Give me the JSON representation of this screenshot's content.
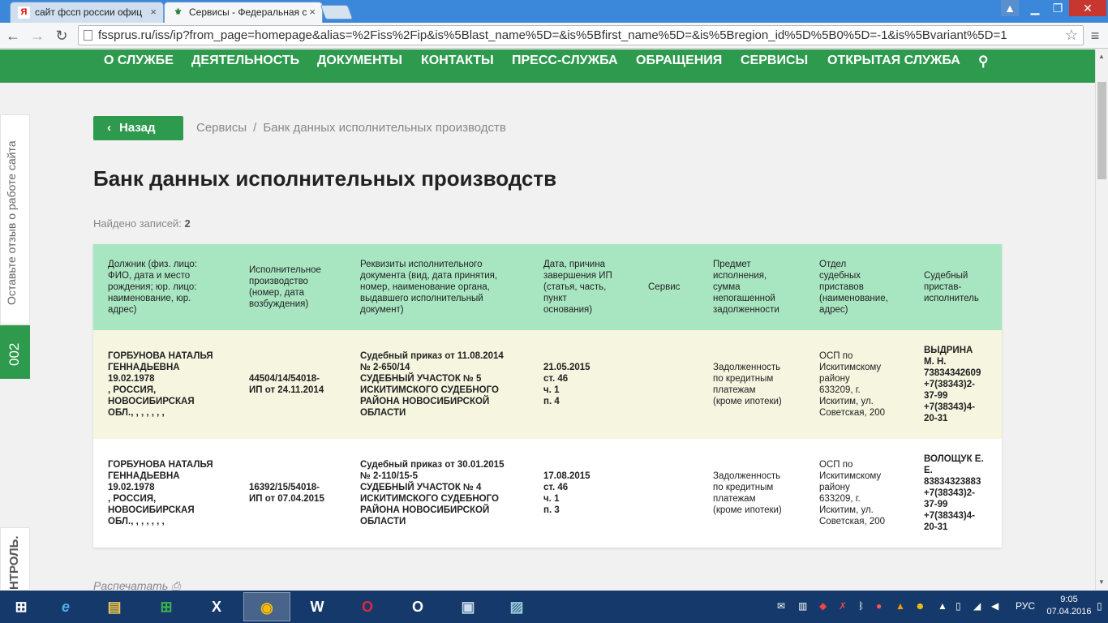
{
  "browser": {
    "tabs": [
      {
        "favicon": "Я",
        "label": "сайт фссп россии офиц",
        "active": false
      },
      {
        "favicon": "⚜",
        "label": "Сервисы - Федеральная с",
        "active": true
      }
    ],
    "url": "fssprus.ru/iss/ip?from_page=homepage&alias=%2Fiss%2Fip&is%5Blast_name%5D=&is%5Bfirst_name%5D=&is%5Bregion_id%5D%5B0%5D=-1&is%5Bvariant%5D=1",
    "window_buttons": [
      "▁",
      "❐",
      "✕"
    ]
  },
  "nav": {
    "items": [
      "О СЛУЖБЕ",
      "ДЕЯТЕЛЬНОСТЬ",
      "ДОКУМЕНТЫ",
      "КОНТАКТЫ",
      "ПРЕСС-СЛУЖБА",
      "ОБРАЩЕНИЯ",
      "СЕРВИСЫ",
      "ОТКРЫТАЯ СЛУЖБА"
    ],
    "search_icon": "search-icon"
  },
  "side": {
    "feedback": "Оставьте отзыв о работе сайта",
    "counter": "002",
    "kontrol": "НТРОЛЬ."
  },
  "page": {
    "back_label": "Назад",
    "breadcrumb": [
      "Сервисы",
      "Банк данных исполнительных производств"
    ],
    "breadcrumb_sep": "/",
    "title": "Банк данных исполнительных производств",
    "found_label": "Найдено записей:",
    "found_count": "2",
    "print_label": "Распечатать"
  },
  "table": {
    "headers": [
      "Должник (физ. лицо:\nФИО, дата и место\nрождения; юр. лицо:\nнаименование, юр.\nадрес)",
      "Исполнительное\nпроизводство\n(номер, дата\nвозбуждения)",
      "Реквизиты исполнительного\nдокумента (вид, дата принятия,\nномер, наименование органа,\nвыдавшего исполнительный\nдокумент)",
      "Дата, причина\nзавершения ИП\n(статья, часть,\nпункт\nоснования)",
      "Сервис",
      "Предмет\nисполнения,\nсумма\nнепогашенной\nзадолженности",
      "Отдел\nсудебных\nприставов\n(наименование,\nадрес)",
      "Судебный\nпристав-\nисполнитель"
    ],
    "rows": [
      {
        "debtor": "ГОРБУНОВА НАТАЛЬЯ\nГЕННАДЬЕВНА\n19.02.1978\n, РОССИЯ,\nНОВОСИБИРСКАЯ\nОБЛ., , , , , , ,",
        "proceeding": "44504/14/54018-\nИП от 24.11.2014",
        "document": "Судебный приказ от 11.08.2014\n№ 2-650/14\nСУДЕБНЫЙ УЧАСТОК № 5\nИСКИТИМСКОГО СУДЕБНОГО\nРАЙОНА НОВОСИБИРСКОЙ\nОБЛАСТИ",
        "end": "21.05.2015\nст. 46\nч. 1\nп. 4",
        "service": "",
        "subject": "Задолженность\nпо кредитным\nплатежам\n(кроме ипотеки)",
        "department": "ОСП по\nИскитимскому\nрайону\n633209, г.\nИскитим, ул.\nСоветская, 200",
        "bailiff": "ВЫДРИНА\nМ. Н.\n73834342609\n+7(38343)2-\n37-99\n+7(38343)4-\n20-31"
      },
      {
        "debtor": "ГОРБУНОВА НАТАЛЬЯ\nГЕННАДЬЕВНА\n19.02.1978\n, РОССИЯ,\nНОВОСИБИРСКАЯ\nОБЛ., , , , , , ,",
        "proceeding": "16392/15/54018-\nИП от 07.04.2015",
        "document": "Судебный приказ от 30.01.2015\n№ 2-110/15-5\nСУДЕБНЫЙ УЧАСТОК № 4\nИСКИТИМСКОГО СУДЕБНОГО\nРАЙОНА НОВОСИБИРСКОЙ\nОБЛАСТИ",
        "end": "17.08.2015\nст. 46\nч. 1\nп. 3",
        "service": "",
        "subject": "Задолженность\nпо кредитным\nплатежам\n(кроме ипотеки)",
        "department": "ОСП по\nИскитимскому\nрайону\n633209, г.\nИскитим, ул.\nСоветская, 200",
        "bailiff": "ВОЛОЩУК Е.\nЕ.\n83834323883\n+7(38343)2-\n37-99\n+7(38343)4-\n20-31"
      }
    ]
  },
  "taskbar": {
    "apps": [
      {
        "name": "start-button",
        "glyph": "⊞"
      },
      {
        "name": "ie-icon",
        "glyph": "e"
      },
      {
        "name": "explorer-icon",
        "glyph": "▤"
      },
      {
        "name": "store-icon",
        "glyph": "⊞"
      },
      {
        "name": "excel-icon",
        "glyph": "X"
      },
      {
        "name": "chrome-icon",
        "glyph": "◉"
      },
      {
        "name": "word-icon",
        "glyph": "W"
      },
      {
        "name": "opera-icon",
        "glyph": "O"
      },
      {
        "name": "outlook-icon",
        "glyph": "O"
      },
      {
        "name": "remote-desktop-icon",
        "glyph": "▣"
      },
      {
        "name": "photos-icon",
        "glyph": "▨"
      }
    ],
    "language": "РУС",
    "time": "9:05",
    "date": "07.04.2016"
  }
}
